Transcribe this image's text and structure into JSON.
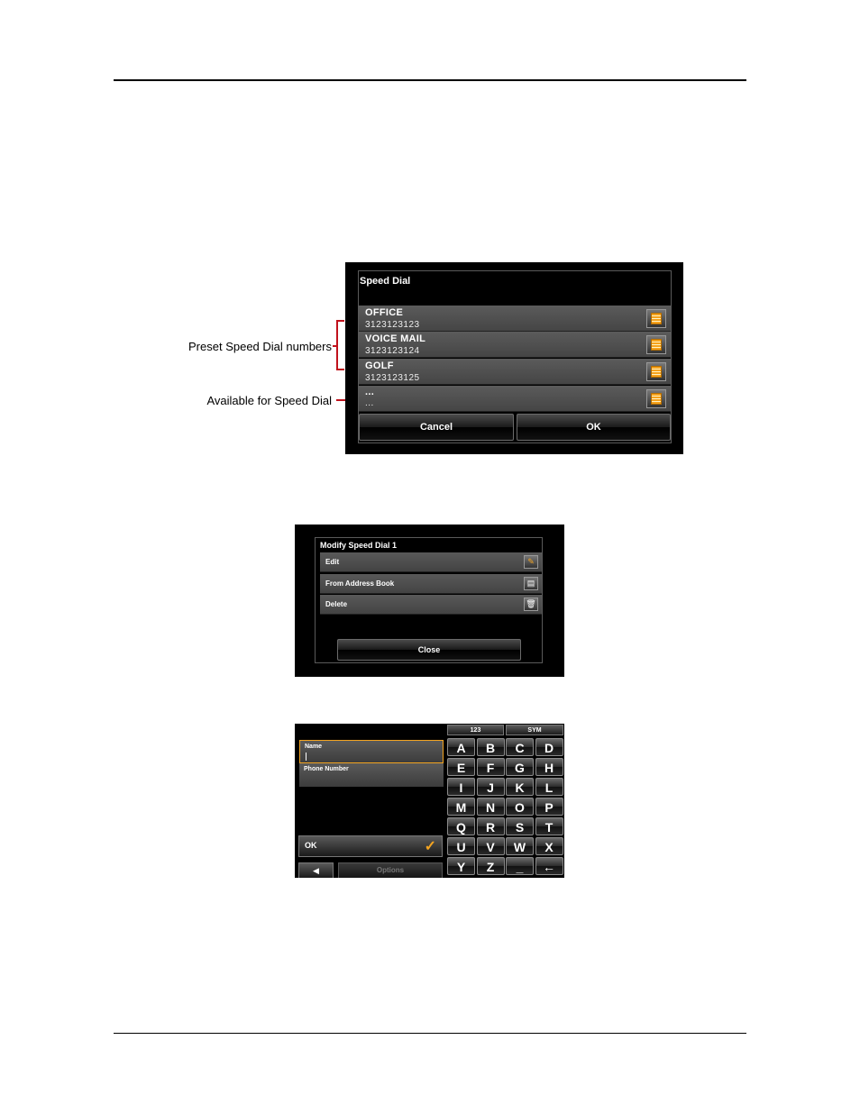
{
  "annotations": {
    "preset_label": "Preset Speed Dial numbers",
    "available_label": "Available for Speed Dial"
  },
  "speed_dial": {
    "title": "Speed Dial",
    "entries": [
      {
        "name": "OFFICE",
        "number": "3123123123"
      },
      {
        "name": "VOICE MAIL",
        "number": "3123123124"
      },
      {
        "name": "GOLF",
        "number": "3123123125"
      },
      {
        "name": "...",
        "number": "..."
      }
    ],
    "cancel_label": "Cancel",
    "ok_label": "OK",
    "accent_color": "#f6a21d"
  },
  "modify": {
    "title": "Modify Speed Dial 1",
    "items": [
      {
        "label": "Edit",
        "icon": "pencil-icon"
      },
      {
        "label": "From Address Book",
        "icon": "address-book-icon"
      },
      {
        "label": "Delete",
        "icon": "trash-icon"
      }
    ],
    "close_label": "Close"
  },
  "keyboard": {
    "name_label": "Name",
    "name_value": "",
    "phone_label": "Phone Number",
    "ok_label": "OK",
    "options_label": "Options",
    "tab_numbers": "123",
    "tab_symbols": "SYM",
    "keys": [
      "A",
      "B",
      "C",
      "D",
      "E",
      "F",
      "G",
      "H",
      "I",
      "J",
      "K",
      "L",
      "M",
      "N",
      "O",
      "P",
      "Q",
      "R",
      "S",
      "T",
      "U",
      "V",
      "W",
      "X",
      "Y",
      "Z",
      "_",
      "←"
    ],
    "focus_color": "#f3a421"
  }
}
